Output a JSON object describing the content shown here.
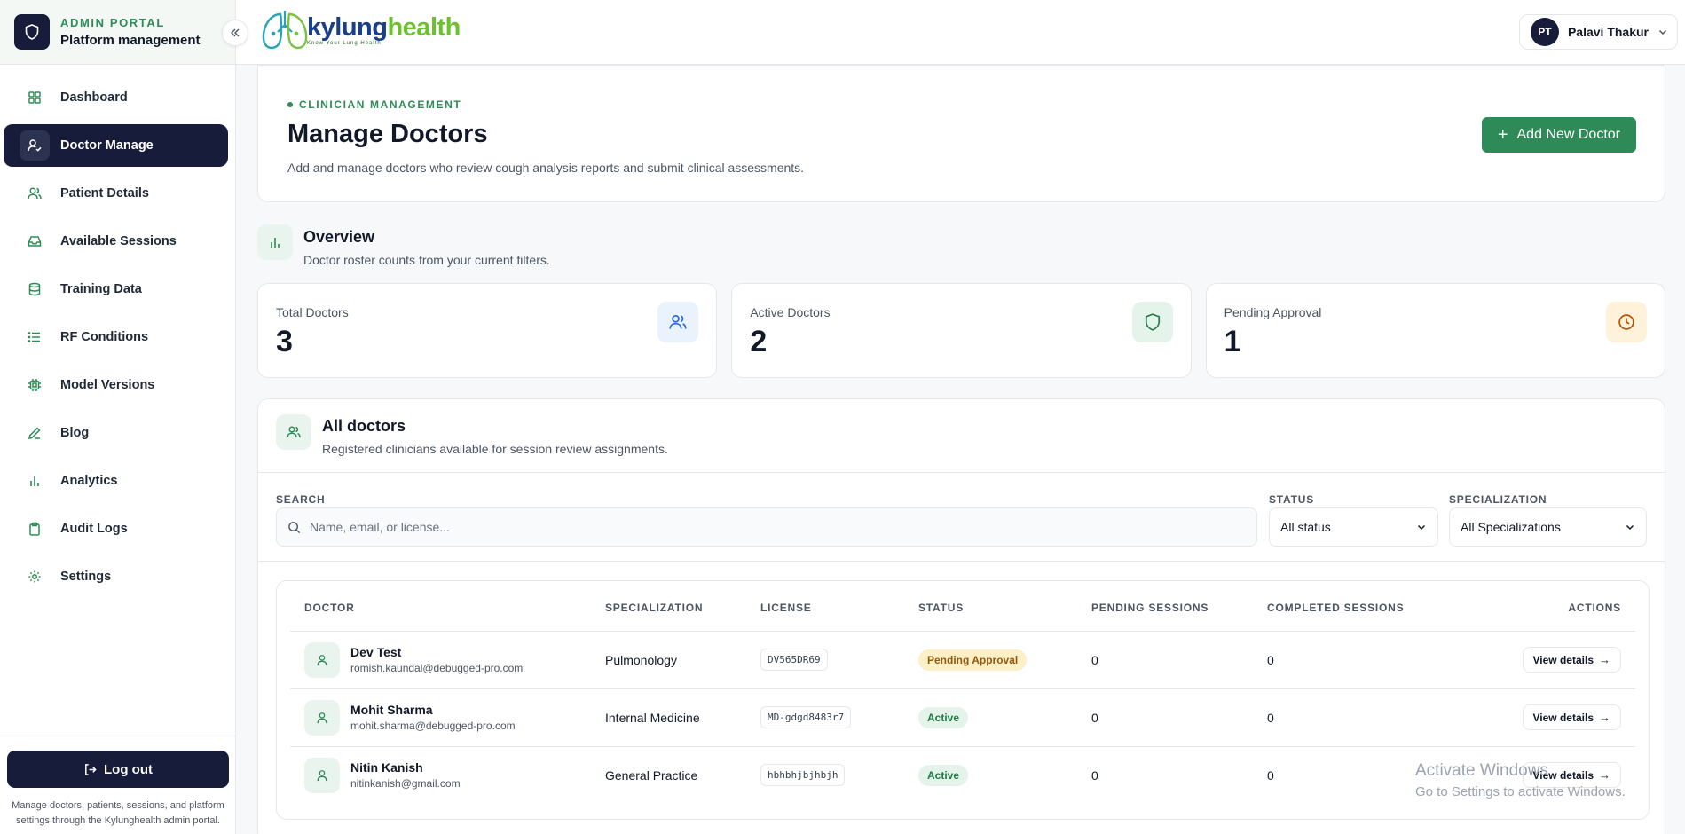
{
  "sidebar": {
    "kicker": "ADMIN PORTAL",
    "title": "Platform management",
    "items": [
      {
        "label": "Dashboard",
        "icon": "grid-icon"
      },
      {
        "label": "Doctor Manage",
        "icon": "user-check-icon",
        "active": true
      },
      {
        "label": "Patient Details",
        "icon": "users-icon"
      },
      {
        "label": "Available Sessions",
        "icon": "inbox-icon"
      },
      {
        "label": "Training Data",
        "icon": "database-icon"
      },
      {
        "label": "RF Conditions",
        "icon": "list-icon"
      },
      {
        "label": "Model Versions",
        "icon": "cpu-icon"
      },
      {
        "label": "Blog",
        "icon": "pen-icon"
      },
      {
        "label": "Analytics",
        "icon": "bar-chart-icon"
      },
      {
        "label": "Audit Logs",
        "icon": "clipboard-icon"
      },
      {
        "label": "Settings",
        "icon": "gear-icon"
      }
    ],
    "logout_label": "Log out",
    "footer_note": "Manage doctors, patients, sessions, and platform settings through the Kylunghealth admin portal."
  },
  "topbar": {
    "logo_k": "kylung",
    "logo_h": "health",
    "logo_tag": "Know Your Lung Health",
    "user_initials": "PT",
    "user_name": "Palavi Thakur"
  },
  "header": {
    "kicker": "CLINICIAN MANAGEMENT",
    "title": "Manage Doctors",
    "subtitle": "Add and manage doctors who review cough analysis reports and submit clinical assessments.",
    "add_label": "Add New Doctor"
  },
  "overview": {
    "title": "Overview",
    "subtitle": "Doctor roster counts from your current filters.",
    "stats": [
      {
        "label": "Total Doctors",
        "value": "3",
        "icon": "users-icon",
        "color": "#3b82f6"
      },
      {
        "label": "Active Doctors",
        "value": "2",
        "icon": "shield-icon",
        "color": "#2e8b57"
      },
      {
        "label": "Pending Approval",
        "value": "1",
        "icon": "clock-icon",
        "color": "#d97706"
      }
    ]
  },
  "list": {
    "title": "All doctors",
    "subtitle": "Registered clinicians available for session review assignments.",
    "search_label": "SEARCH",
    "search_placeholder": "Name, email, or license...",
    "status_label": "STATUS",
    "status_value": "All status",
    "spec_label": "SPECIALIZATION",
    "spec_value": "All Specializations",
    "columns": [
      "DOCTOR",
      "SPECIALIZATION",
      "LICENSE",
      "STATUS",
      "PENDING SESSIONS",
      "COMPLETED SESSIONS",
      "ACTIONS"
    ],
    "rows": [
      {
        "name": "Dev Test",
        "email": "romish.kaundal@debugged-pro.com",
        "specialization": "Pulmonology",
        "license": "DV565DR69",
        "status": "Pending Approval",
        "pending": "0",
        "completed": "0",
        "action": "View details"
      },
      {
        "name": "Mohit Sharma",
        "email": "mohit.sharma@debugged-pro.com",
        "specialization": "Internal Medicine",
        "license": "MD-gdgd8483r7",
        "status": "Active",
        "pending": "0",
        "completed": "0",
        "action": "View details"
      },
      {
        "name": "Nitin Kanish",
        "email": "nitinkanish@gmail.com",
        "specialization": "General Practice",
        "license": "hbhbhjbjhbjh",
        "status": "Active",
        "pending": "0",
        "completed": "0",
        "action": "View details"
      }
    ]
  },
  "watermark": {
    "line1": "Activate Windows",
    "line2": "Go to Settings to activate Windows."
  }
}
